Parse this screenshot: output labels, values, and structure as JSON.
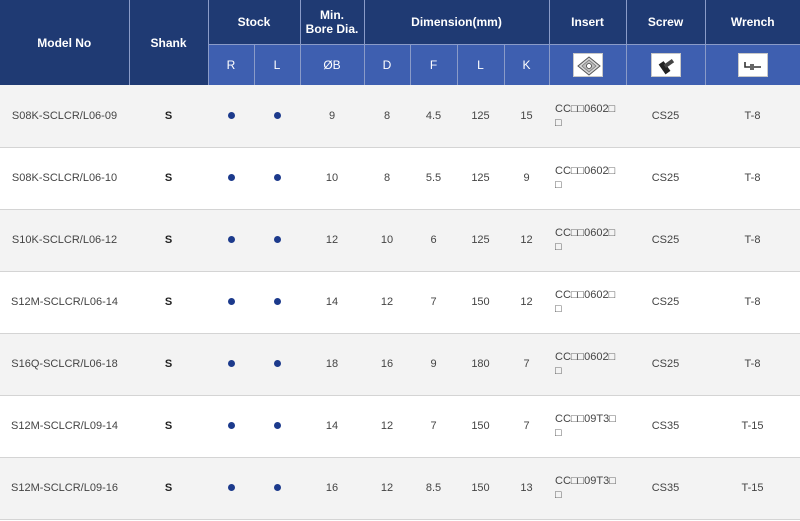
{
  "colors": {
    "header_dark": "#1f3a73",
    "header_light": "#3e5fb0",
    "dot": "#1c3a8c"
  },
  "headers": {
    "model": "Model No",
    "shank": "Shank",
    "stock": "Stock",
    "stock_r": "R",
    "stock_l": "L",
    "bore_line1": "Min.",
    "bore_line2": "Bore Dia.",
    "bore_sub": "ØB",
    "dimension": "Dimension(mm)",
    "dim_d": "D",
    "dim_f": "F",
    "dim_l": "L",
    "dim_k": "K",
    "insert": "Insert",
    "screw": "Screw",
    "wrench": "Wrench"
  },
  "icons": {
    "insert": "insert-square-icon",
    "screw": "screw-icon",
    "wrench": "wrench-icon"
  },
  "rows": [
    {
      "model": "S08K-SCLCR/L06-09",
      "shank": "S",
      "stock_r": true,
      "stock_l": true,
      "bore": "9",
      "d": "8",
      "f": "4.5",
      "l": "125",
      "k": "15",
      "insert_a": "CC□□0602□",
      "insert_b": "□",
      "screw": "CS25",
      "wrench": "T-8"
    },
    {
      "model": "S08K-SCLCR/L06-10",
      "shank": "S",
      "stock_r": true,
      "stock_l": true,
      "bore": "10",
      "d": "8",
      "f": "5.5",
      "l": "125",
      "k": "9",
      "insert_a": "CC□□0602□",
      "insert_b": "□",
      "screw": "CS25",
      "wrench": "T-8"
    },
    {
      "model": "S10K-SCLCR/L06-12",
      "shank": "S",
      "stock_r": true,
      "stock_l": true,
      "bore": "12",
      "d": "10",
      "f": "6",
      "l": "125",
      "k": "12",
      "insert_a": "CC□□0602□",
      "insert_b": "□",
      "screw": "CS25",
      "wrench": "T-8"
    },
    {
      "model": "S12M-SCLCR/L06-14",
      "shank": "S",
      "stock_r": true,
      "stock_l": true,
      "bore": "14",
      "d": "12",
      "f": "7",
      "l": "150",
      "k": "12",
      "insert_a": "CC□□0602□",
      "insert_b": "□",
      "screw": "CS25",
      "wrench": "T-8"
    },
    {
      "model": "S16Q-SCLCR/L06-18",
      "shank": "S",
      "stock_r": true,
      "stock_l": true,
      "bore": "18",
      "d": "16",
      "f": "9",
      "l": "180",
      "k": "7",
      "insert_a": "CC□□0602□",
      "insert_b": "□",
      "screw": "CS25",
      "wrench": "T-8"
    },
    {
      "model": "S12M-SCLCR/L09-14",
      "shank": "S",
      "stock_r": true,
      "stock_l": true,
      "bore": "14",
      "d": "12",
      "f": "7",
      "l": "150",
      "k": "7",
      "insert_a": "CC□□09T3□",
      "insert_b": "□",
      "screw": "CS35",
      "wrench": "T-15"
    },
    {
      "model": "S12M-SCLCR/L09-16",
      "shank": "S",
      "stock_r": true,
      "stock_l": true,
      "bore": "16",
      "d": "12",
      "f": "8.5",
      "l": "150",
      "k": "13",
      "insert_a": "CC□□09T3□",
      "insert_b": "□",
      "screw": "CS35",
      "wrench": "T-15"
    }
  ]
}
